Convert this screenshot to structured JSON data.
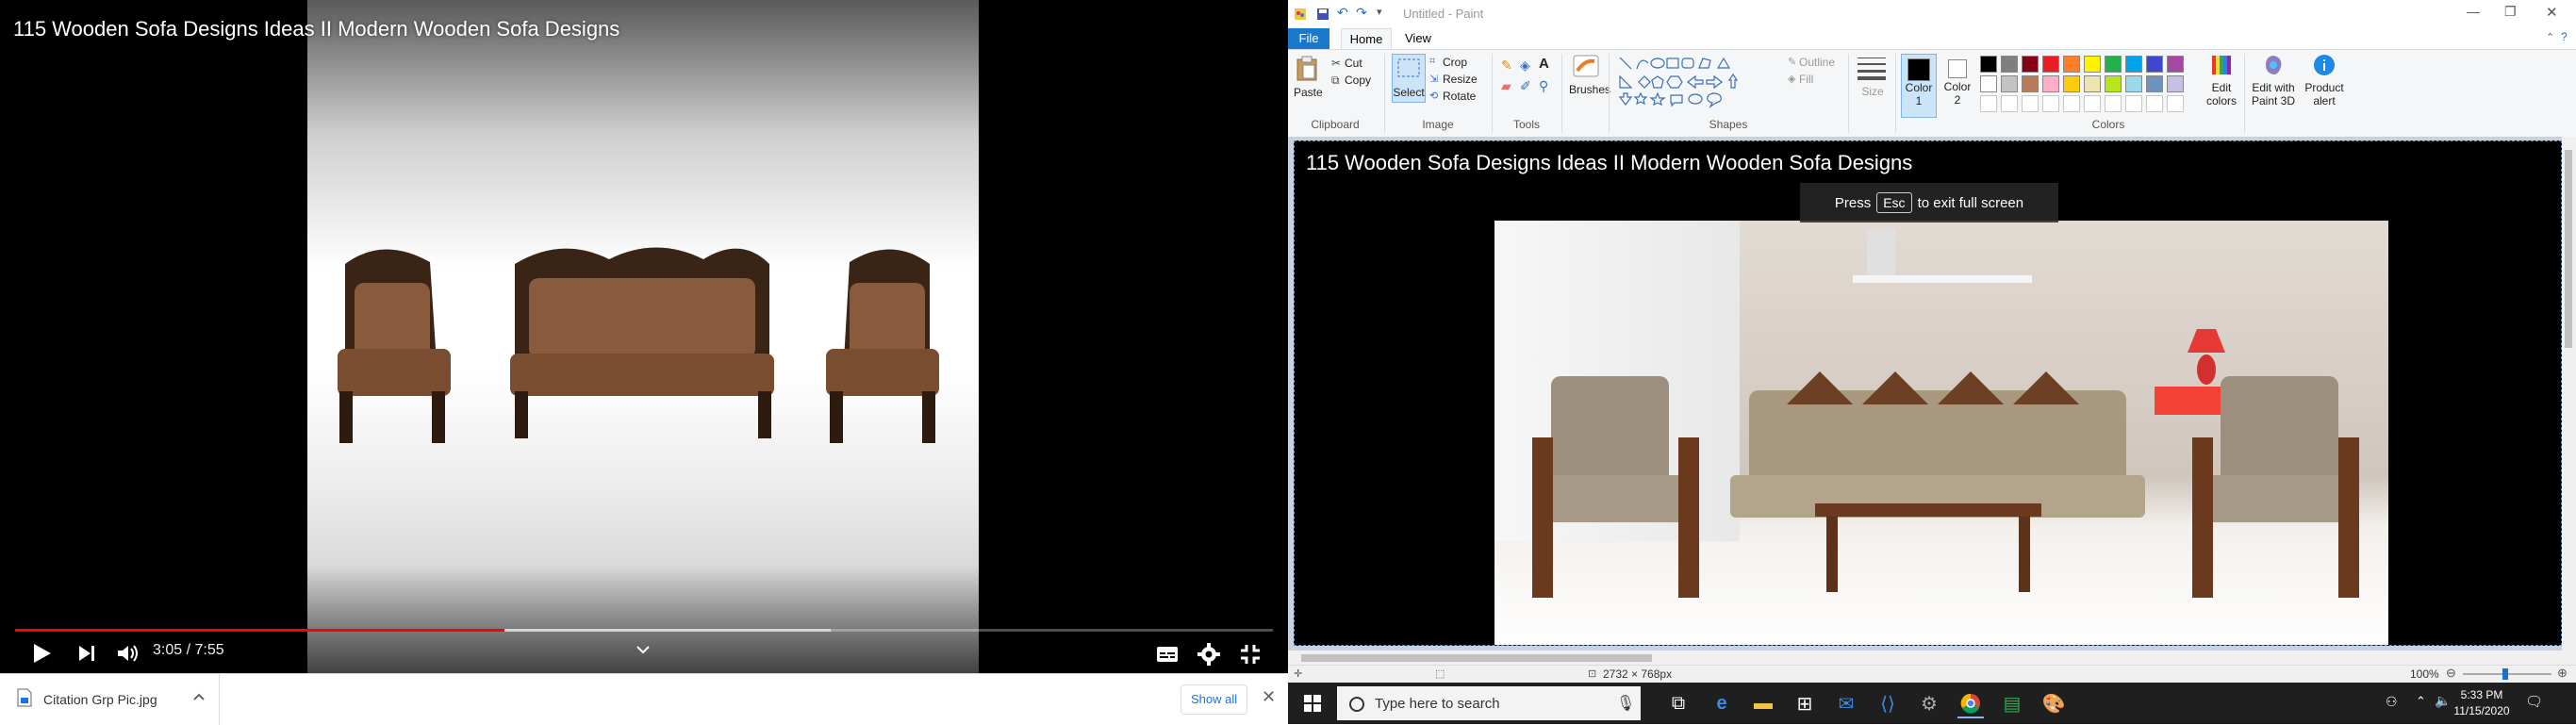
{
  "youtube": {
    "title": "115 Wooden Sofa Designs Ideas II Modern Wooden Sofa Designs",
    "time": "3:05 / 7:55",
    "progress_fraction": 0.389,
    "icons": {
      "play": "play-icon",
      "next": "next-icon",
      "volume": "volume-icon",
      "chevron": "chevron-down-icon",
      "subtitles": "subtitles-icon",
      "settings": "gear-icon",
      "exit_fullscreen": "exit-fullscreen-icon"
    }
  },
  "download_bar": {
    "file_name": "Citation Grp Pic.jpg",
    "show_all": "Show all"
  },
  "paint": {
    "window_title": "Untitled - Paint",
    "tabs": {
      "file": "File",
      "home": "Home",
      "view": "View"
    },
    "clipboard": {
      "paste": "Paste",
      "cut": "Cut",
      "copy": "Copy",
      "label": "Clipboard"
    },
    "image": {
      "select": "Select",
      "crop": "Crop",
      "resize": "Resize",
      "rotate": "Rotate",
      "label": "Image"
    },
    "tools": {
      "label": "Tools"
    },
    "brushes": {
      "label": "Brushes"
    },
    "shapes": {
      "outline": "Outline",
      "fill": "Fill",
      "label": "Shapes"
    },
    "size": {
      "label": "Size"
    },
    "color1": {
      "label": "Color",
      "num": "1"
    },
    "color2": {
      "label": "Color",
      "num": "2"
    },
    "colors": {
      "label": "Colors",
      "palette_row1": [
        "#000000",
        "#7f7f7f",
        "#880015",
        "#ed1c24",
        "#ff7f27",
        "#fff200",
        "#22b14c",
        "#00a2e8",
        "#3f48cc",
        "#a349a4"
      ],
      "palette_row2": [
        "#ffffff",
        "#c3c3c3",
        "#b97a57",
        "#ffaec9",
        "#ffc90e",
        "#efe4b0",
        "#b5e61d",
        "#99d9ea",
        "#7092be",
        "#c8bfe7"
      ]
    },
    "edit_colors": {
      "line1": "Edit",
      "line2": "colors"
    },
    "edit_paint3d": {
      "line1": "Edit with",
      "line2": "Paint 3D"
    },
    "product_alert": {
      "line1": "Product",
      "line2": "alert"
    },
    "canvas": {
      "title": "115 Wooden Sofa Designs Ideas II Modern Wooden Sofa Designs",
      "esc_press": "Press",
      "esc_key": "Esc",
      "esc_rest": "to exit full screen"
    },
    "status": {
      "dimensions": "2732 × 768px",
      "zoom": "100%"
    }
  },
  "taskbar": {
    "search_placeholder": "Type here to search",
    "time": "5:33 PM",
    "date": "11/15/2020"
  }
}
